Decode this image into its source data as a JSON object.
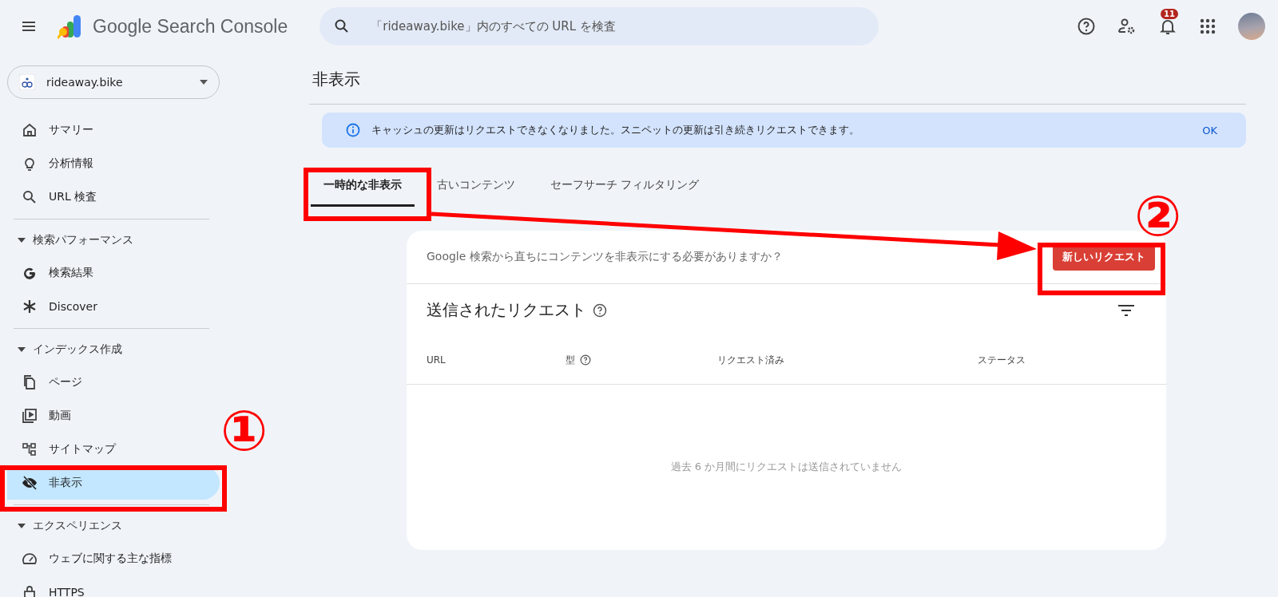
{
  "header": {
    "app_name": "Google Search Console",
    "search": {
      "placeholder": "「rideaway.bike」内のすべての URL を検査"
    },
    "notifications": "11"
  },
  "property": {
    "name": "rideaway.bike"
  },
  "sidebar": [
    {
      "items": [
        {
          "label": "サマリー",
          "selected": false
        },
        {
          "label": "分析情報",
          "selected": false
        },
        {
          "label": "URL 検査",
          "selected": false
        }
      ]
    },
    {
      "title": "検索パフォーマンス",
      "expanded": true,
      "items": [
        {
          "label": "検索結果",
          "selected": false
        },
        {
          "label": "Discover",
          "selected": false
        }
      ]
    },
    {
      "title": "インデックス作成",
      "expanded": true,
      "items": [
        {
          "label": "ページ",
          "selected": false
        },
        {
          "label": "動画",
          "selected": false
        },
        {
          "label": "サイトマップ",
          "selected": false
        },
        {
          "label": "非表示",
          "selected": true
        }
      ]
    },
    {
      "title": "エクスペリエンス",
      "expanded": true,
      "items": [
        {
          "label": "ウェブに関する主な指標",
          "selected": false
        },
        {
          "label": "HTTPS",
          "selected": false
        }
      ]
    }
  ],
  "page": {
    "title": "非表示",
    "banner": {
      "text": "キャッシュの更新はリクエストできなくなりました。スニペットの更新は引き続きリクエストできます。",
      "action": "OK"
    },
    "tabs": [
      {
        "label": "一時的な非表示",
        "selected": true
      },
      {
        "label": "古いコンテンツ",
        "selected": false
      },
      {
        "label": "セーフサーチ フィルタリング",
        "selected": false
      }
    ],
    "card": {
      "prompt": "Google 検索から直ちにコンテンツを非表示にする必要がありますか？",
      "button": "新しいリクエスト",
      "title": "送信されたリクエスト",
      "columns": [
        {
          "label": "URL",
          "kind": "text"
        },
        {
          "label": "型",
          "kind": "help"
        },
        {
          "label": "リクエスト済み",
          "kind": "text"
        },
        {
          "label": "ステータス",
          "kind": "text"
        }
      ],
      "empty": "過去 6 か月間にリクエストは送信されていません"
    }
  },
  "annotations": [
    {
      "label": "①"
    },
    {
      "label": "②"
    }
  ]
}
